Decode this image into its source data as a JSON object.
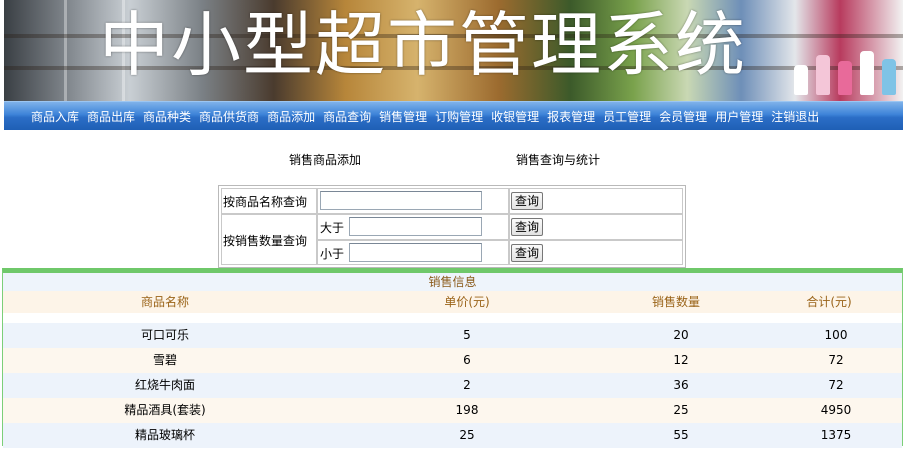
{
  "banner": {
    "title": "中小型超市管理系统"
  },
  "nav": {
    "items": [
      {
        "label": "商品入库"
      },
      {
        "label": "商品出库"
      },
      {
        "label": "商品种类"
      },
      {
        "label": "商品供货商"
      },
      {
        "label": "商品添加"
      },
      {
        "label": "商品查询"
      },
      {
        "label": "销售管理"
      },
      {
        "label": "订购管理"
      },
      {
        "label": "收银管理"
      },
      {
        "label": "报表管理"
      },
      {
        "label": "员工管理"
      },
      {
        "label": "会员管理"
      },
      {
        "label": "用户管理"
      },
      {
        "label": "注销退出"
      }
    ]
  },
  "links": {
    "add": "销售商品添加",
    "query": "销售查询与统计"
  },
  "search": {
    "by_name_label": "按商品名称查询",
    "by_qty_label": "按销售数量查询",
    "greater_label": "大于",
    "less_label": "小于",
    "name_value": "",
    "greater_value": "",
    "less_value": "",
    "button_label": "查询"
  },
  "results": {
    "title": "销售信息",
    "columns": [
      "商品名称",
      "单价(元)",
      "销售数量",
      "合计(元)"
    ],
    "rows": [
      [
        "可口可乐",
        "5",
        "20",
        "100"
      ],
      [
        "雪碧",
        "6",
        "12",
        "72"
      ],
      [
        "红烧牛肉面",
        "2",
        "36",
        "72"
      ],
      [
        "精品酒具(套装)",
        "198",
        "25",
        "4950"
      ],
      [
        "精品玻璃杯",
        "25",
        "55",
        "1375"
      ]
    ]
  }
}
